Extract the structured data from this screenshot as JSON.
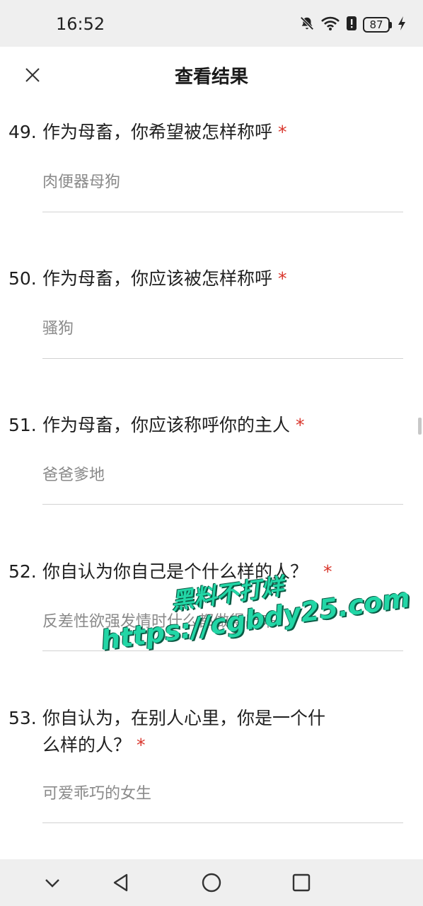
{
  "status_bar": {
    "time": "16:52",
    "battery": "87",
    "icons": [
      "bell-off-icon",
      "wifi-icon",
      "alert-icon",
      "battery-icon",
      "charging-icon"
    ]
  },
  "header": {
    "title": "查看结果",
    "close_icon": "close-icon"
  },
  "questions": [
    {
      "number": "49.",
      "text": "作为母畜，你希望被怎样称呼",
      "required": "*",
      "answer": "肉便器母狗"
    },
    {
      "number": "50.",
      "text": "作为母畜，你应该被怎样称呼",
      "required": "*",
      "answer": "骚狗"
    },
    {
      "number": "51.",
      "text": "作为母畜，你应该称呼你的主人",
      "required": "*",
      "answer": "爸爸爹地"
    },
    {
      "number": "52.",
      "text": "你自认为你自己是个什么样的人？",
      "required": "*",
      "answer": "反差性欲强发情时什么都做得出来"
    },
    {
      "number": "53.",
      "text_line1": "你自认为，在别人心里，你是一个什",
      "text_line2": "么样的人？",
      "required": "*",
      "answer": "可爱乖巧的女生"
    }
  ],
  "watermark": {
    "line1": "黑料不打烊",
    "line2": "https://cgbdy25.com"
  },
  "nav_bar": {
    "icons": [
      "chevron-down-icon",
      "back-icon",
      "home-icon",
      "recents-icon"
    ]
  },
  "colors": {
    "required": "#d9352b",
    "answer_text": "#8a8a8a",
    "watermark": "#22d6a6",
    "bar_bg": "#efefef"
  }
}
